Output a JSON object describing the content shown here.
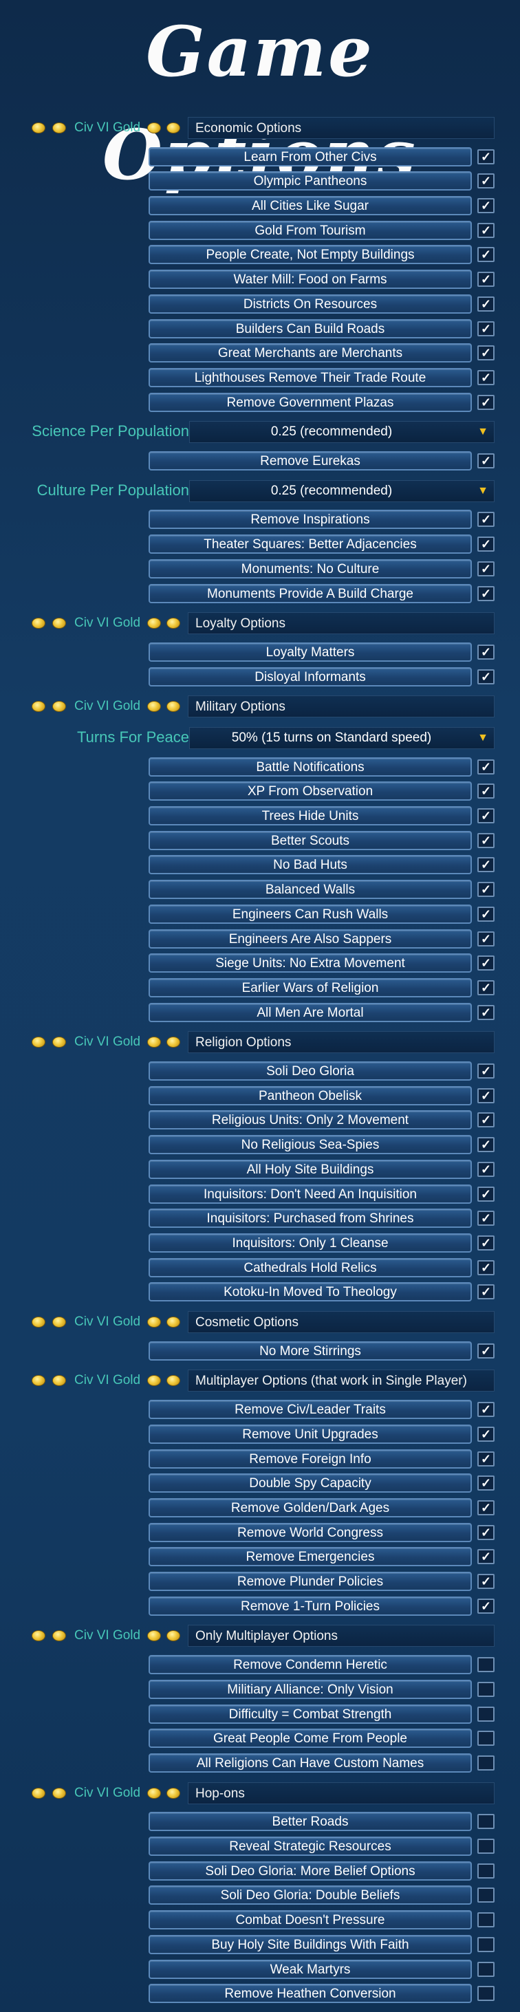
{
  "title": "Game Options",
  "gold_label": "Civ VI Gold",
  "sections": [
    {
      "type": "header",
      "label": "Economic Options"
    },
    {
      "type": "toggle",
      "label": "Learn From Other Civs",
      "checked": true
    },
    {
      "type": "toggle",
      "label": "Olympic Pantheons",
      "checked": true
    },
    {
      "type": "toggle",
      "label": "All Cities Like Sugar",
      "checked": true
    },
    {
      "type": "toggle",
      "label": "Gold From Tourism",
      "checked": true
    },
    {
      "type": "toggle",
      "label": "People Create, Not Empty Buildings",
      "checked": true
    },
    {
      "type": "toggle",
      "label": "Water Mill: Food on Farms",
      "checked": true
    },
    {
      "type": "toggle",
      "label": "Districts On Resources",
      "checked": true
    },
    {
      "type": "toggle",
      "label": "Builders Can Build Roads",
      "checked": true
    },
    {
      "type": "toggle",
      "label": "Great Merchants are Merchants",
      "checked": true
    },
    {
      "type": "toggle",
      "label": "Lighthouses Remove Their Trade Route",
      "checked": true
    },
    {
      "type": "toggle",
      "label": "Remove Government Plazas",
      "checked": true
    },
    {
      "type": "dropdown",
      "label": "Science Per Population",
      "value": "0.25 (recommended)"
    },
    {
      "type": "toggle",
      "label": "Remove Eurekas",
      "checked": true
    },
    {
      "type": "dropdown",
      "label": "Culture Per Population",
      "value": "0.25 (recommended)"
    },
    {
      "type": "toggle",
      "label": "Remove Inspirations",
      "checked": true
    },
    {
      "type": "toggle",
      "label": "Theater Squares: Better Adjacencies",
      "checked": true
    },
    {
      "type": "toggle",
      "label": "Monuments: No Culture",
      "checked": true
    },
    {
      "type": "toggle",
      "label": "Monuments Provide A Build Charge",
      "checked": true
    },
    {
      "type": "header",
      "label": "Loyalty Options"
    },
    {
      "type": "toggle",
      "label": "Loyalty Matters",
      "checked": true
    },
    {
      "type": "toggle",
      "label": "Disloyal Informants",
      "checked": true
    },
    {
      "type": "header",
      "label": "Military Options"
    },
    {
      "type": "dropdown",
      "label": "Turns For Peace",
      "value": "50% (15 turns on Standard speed)"
    },
    {
      "type": "toggle",
      "label": "Battle Notifications",
      "checked": true
    },
    {
      "type": "toggle",
      "label": "XP From Observation",
      "checked": true
    },
    {
      "type": "toggle",
      "label": "Trees Hide Units",
      "checked": true
    },
    {
      "type": "toggle",
      "label": "Better Scouts",
      "checked": true
    },
    {
      "type": "toggle",
      "label": "No Bad Huts",
      "checked": true
    },
    {
      "type": "toggle",
      "label": "Balanced Walls",
      "checked": true
    },
    {
      "type": "toggle",
      "label": "Engineers Can Rush Walls",
      "checked": true
    },
    {
      "type": "toggle",
      "label": "Engineers Are Also Sappers",
      "checked": true
    },
    {
      "type": "toggle",
      "label": "Siege Units: No Extra Movement",
      "checked": true
    },
    {
      "type": "toggle",
      "label": "Earlier Wars of Religion",
      "checked": true
    },
    {
      "type": "toggle",
      "label": "All Men Are Mortal",
      "checked": true
    },
    {
      "type": "header",
      "label": "Religion Options"
    },
    {
      "type": "toggle",
      "label": "Soli Deo Gloria",
      "checked": true
    },
    {
      "type": "toggle",
      "label": "Pantheon Obelisk",
      "checked": true
    },
    {
      "type": "toggle",
      "label": "Religious Units: Only 2 Movement",
      "checked": true
    },
    {
      "type": "toggle",
      "label": "No Religious Sea-Spies",
      "checked": true
    },
    {
      "type": "toggle",
      "label": "All Holy Site Buildings",
      "checked": true
    },
    {
      "type": "toggle",
      "label": "Inquisitors: Don't Need An Inquisition",
      "checked": true
    },
    {
      "type": "toggle",
      "label": "Inquisitors: Purchased from Shrines",
      "checked": true
    },
    {
      "type": "toggle",
      "label": "Inquisitors: Only 1 Cleanse",
      "checked": true
    },
    {
      "type": "toggle",
      "label": "Cathedrals Hold Relics",
      "checked": true
    },
    {
      "type": "toggle",
      "label": "Kotoku-In Moved To Theology",
      "checked": true
    },
    {
      "type": "header",
      "label": "Cosmetic Options"
    },
    {
      "type": "toggle",
      "label": "No More Stirrings",
      "checked": true
    },
    {
      "type": "header",
      "label": "Multiplayer Options (that work in Single Player)"
    },
    {
      "type": "toggle",
      "label": "Remove Civ/Leader Traits",
      "checked": true
    },
    {
      "type": "toggle",
      "label": "Remove Unit Upgrades",
      "checked": true
    },
    {
      "type": "toggle",
      "label": "Remove Foreign Info",
      "checked": true
    },
    {
      "type": "toggle",
      "label": "Double Spy Capacity",
      "checked": true
    },
    {
      "type": "toggle",
      "label": "Remove Golden/Dark Ages",
      "checked": true
    },
    {
      "type": "toggle",
      "label": "Remove World Congress",
      "checked": true
    },
    {
      "type": "toggle",
      "label": "Remove Emergencies",
      "checked": true
    },
    {
      "type": "toggle",
      "label": "Remove Plunder Policies",
      "checked": true
    },
    {
      "type": "toggle",
      "label": "Remove 1-Turn Policies",
      "checked": true
    },
    {
      "type": "header",
      "label": "Only Multiplayer Options"
    },
    {
      "type": "toggle",
      "label": "Remove Condemn Heretic",
      "checked": false
    },
    {
      "type": "toggle",
      "label": "Militiary Alliance: Only Vision",
      "checked": false
    },
    {
      "type": "toggle",
      "label": "Difficulty = Combat Strength",
      "checked": false
    },
    {
      "type": "toggle",
      "label": "Great People Come From People",
      "checked": false
    },
    {
      "type": "toggle",
      "label": "All Religions Can Have Custom Names",
      "checked": false
    },
    {
      "type": "header",
      "label": "Hop-ons"
    },
    {
      "type": "toggle",
      "label": "Better Roads",
      "checked": false
    },
    {
      "type": "toggle",
      "label": "Reveal Strategic Resources",
      "checked": false
    },
    {
      "type": "toggle",
      "label": "Soli Deo Gloria: More Belief Options",
      "checked": false
    },
    {
      "type": "toggle",
      "label": "Soli Deo Gloria: Double Beliefs",
      "checked": false
    },
    {
      "type": "toggle",
      "label": "Combat Doesn't Pressure",
      "checked": false
    },
    {
      "type": "toggle",
      "label": "Buy Holy Site Buildings With Faith",
      "checked": false
    },
    {
      "type": "toggle",
      "label": "Weak Martyrs",
      "checked": false
    },
    {
      "type": "toggle",
      "label": "Remove Heathen Conversion",
      "checked": false
    }
  ]
}
